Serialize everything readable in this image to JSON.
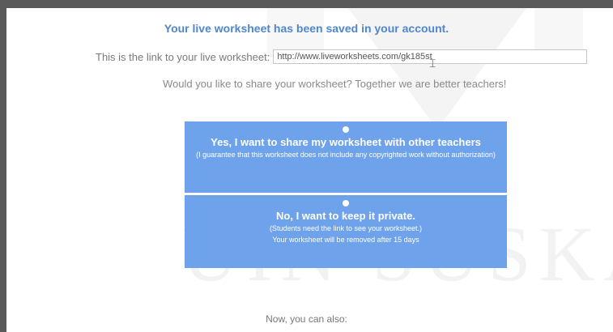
{
  "saved_message": "Your live worksheet has been saved in your account.",
  "link": {
    "label": "This is the link to your live worksheet:",
    "value": "http://www.liveworksheets.com/gk185st"
  },
  "share_question": "Would you like to share your worksheet? Together we are better teachers!",
  "options": [
    {
      "title": "Yes, I want to share my worksheet with other teachers",
      "note": "(I guarantee that this worksheet does not include any copyrighted work without authorization)"
    },
    {
      "title": "No, I want to keep it private.",
      "note": "(Students need the link to see your worksheet.)",
      "note2": "Your worksheet will be removed after 15 days"
    }
  ],
  "footer_text": "Now, you can also:",
  "watermark_text": "UIN SUSKA R",
  "colors": {
    "accent_title": "#4f86cf",
    "option_bg": "#6ea3ec",
    "frame_border": "#5a5a5a"
  },
  "icons": {
    "cursor": "text-cursor-icon",
    "radio": "radio-dot-icon"
  }
}
